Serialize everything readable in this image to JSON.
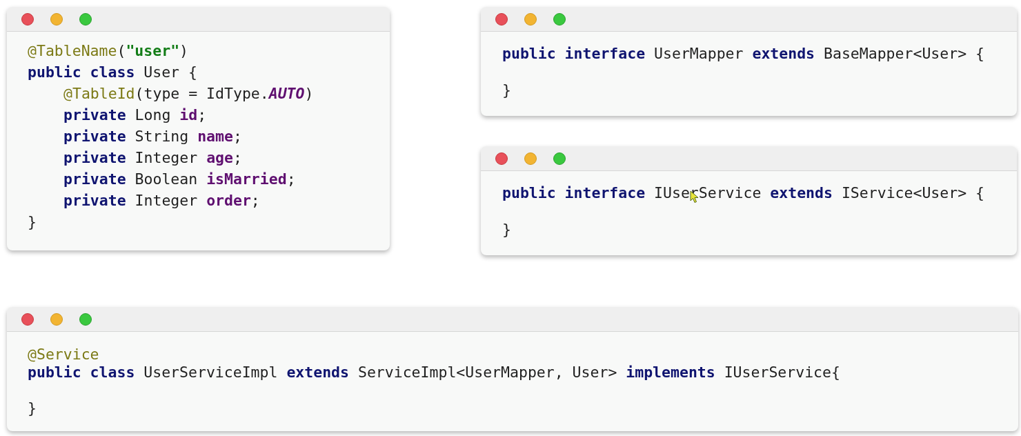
{
  "windows": [
    {
      "lines": [
        {
          "kind": "code",
          "tokens": [
            {
              "kind": "annotation",
              "text": "@TableName"
            },
            {
              "kind": "plain",
              "text": "("
            },
            {
              "kind": "string",
              "text": "\"user\""
            },
            {
              "kind": "plain",
              "text": ")"
            }
          ]
        },
        {
          "kind": "code",
          "tokens": [
            {
              "kind": "keyword",
              "text": "public class "
            },
            {
              "kind": "plain",
              "text": "User {"
            }
          ],
          "children": [
            {
              "kind": "code",
              "tokens": [
                {
                  "kind": "annotation",
                  "text": "@TableId"
                },
                {
                  "kind": "plain",
                  "text": "(type = IdType."
                },
                {
                  "kind": "constant",
                  "text": "AUTO"
                },
                {
                  "kind": "plain",
                  "text": ")"
                }
              ]
            },
            {
              "kind": "code",
              "tokens": [
                {
                  "kind": "keyword",
                  "text": "private "
                },
                {
                  "kind": "plain",
                  "text": "Long "
                },
                {
                  "kind": "field",
                  "text": "id"
                },
                {
                  "kind": "plain",
                  "text": ";"
                }
              ]
            },
            {
              "kind": "code",
              "tokens": [
                {
                  "kind": "keyword",
                  "text": "private "
                },
                {
                  "kind": "plain",
                  "text": "String "
                },
                {
                  "kind": "field",
                  "text": "name"
                },
                {
                  "kind": "plain",
                  "text": ";"
                }
              ]
            },
            {
              "kind": "code",
              "tokens": [
                {
                  "kind": "keyword",
                  "text": "private "
                },
                {
                  "kind": "plain",
                  "text": "Integer "
                },
                {
                  "kind": "field",
                  "text": "age"
                },
                {
                  "kind": "plain",
                  "text": ";"
                }
              ]
            },
            {
              "kind": "code",
              "tokens": [
                {
                  "kind": "keyword",
                  "text": "private "
                },
                {
                  "kind": "plain",
                  "text": "Boolean "
                },
                {
                  "kind": "field",
                  "text": "isMarried"
                },
                {
                  "kind": "plain",
                  "text": ";"
                }
              ]
            },
            {
              "kind": "code",
              "tokens": [
                {
                  "kind": "keyword",
                  "text": "private "
                },
                {
                  "kind": "plain",
                  "text": "Integer "
                },
                {
                  "kind": "field",
                  "text": "order"
                },
                {
                  "kind": "plain",
                  "text": ";"
                }
              ]
            }
          ]
        },
        {
          "kind": "code",
          "tokens": [
            {
              "kind": "plain",
              "text": "}"
            }
          ]
        }
      ]
    },
    {
      "lines": [
        {
          "kind": "code",
          "tokens": [
            {
              "kind": "keyword",
              "text": "public interface "
            },
            {
              "kind": "plain",
              "text": "UserMapper "
            },
            {
              "kind": "keyword",
              "text": "extends "
            },
            {
              "kind": "plain",
              "text": "BaseMapper<User> {"
            }
          ]
        },
        {
          "kind": "blank"
        },
        {
          "kind": "code",
          "tokens": [
            {
              "kind": "plain",
              "text": "}"
            }
          ]
        }
      ]
    },
    {
      "pointer": true,
      "lines": [
        {
          "kind": "code",
          "tokens": [
            {
              "kind": "keyword",
              "text": "public interface "
            },
            {
              "kind": "plain",
              "text": "IUserService "
            },
            {
              "kind": "keyword",
              "text": "extends "
            },
            {
              "kind": "plain",
              "text": "IService<User> {"
            }
          ]
        },
        {
          "kind": "blank"
        },
        {
          "kind": "code",
          "tokens": [
            {
              "kind": "plain",
              "text": "}"
            }
          ]
        }
      ]
    },
    {
      "lines": [
        {
          "kind": "code",
          "tokens": [
            {
              "kind": "annotation",
              "text": "@Service"
            }
          ]
        },
        {
          "kind": "code",
          "tokens": [
            {
              "kind": "keyword",
              "text": "public class "
            },
            {
              "kind": "plain",
              "text": "UserServiceImpl "
            },
            {
              "kind": "keyword",
              "text": "extends "
            },
            {
              "kind": "plain",
              "text": "ServiceImpl<UserMapper, User> "
            },
            {
              "kind": "keyword",
              "text": "implements "
            },
            {
              "kind": "plain",
              "text": "IUserService{"
            }
          ]
        },
        {
          "kind": "blank"
        },
        {
          "kind": "code",
          "tokens": [
            {
              "kind": "plain",
              "text": "}"
            }
          ]
        }
      ]
    }
  ]
}
